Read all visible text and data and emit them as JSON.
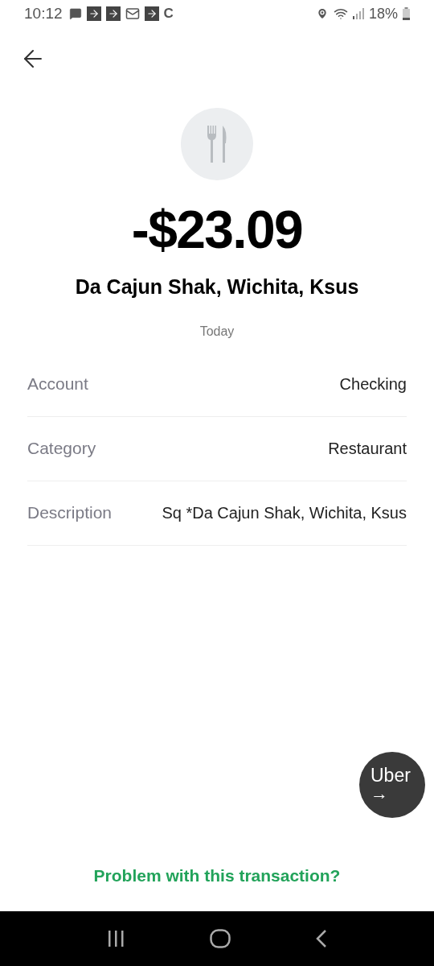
{
  "status_bar": {
    "time": "10:12",
    "notification_letter": "C",
    "battery": "18%"
  },
  "transaction": {
    "amount": "-$23.09",
    "merchant": "Da Cajun Shak, Wichita, Ksus",
    "date": "Today"
  },
  "details": [
    {
      "label": "Account",
      "value": "Checking"
    },
    {
      "label": "Category",
      "value": "Restaurant"
    },
    {
      "label": "Description",
      "value": "Sq *Da Cajun Shak, Wichita, Ksus"
    }
  ],
  "uber_button": {
    "label": "Uber",
    "arrow": "→"
  },
  "problem_link": "Problem with this transaction?"
}
